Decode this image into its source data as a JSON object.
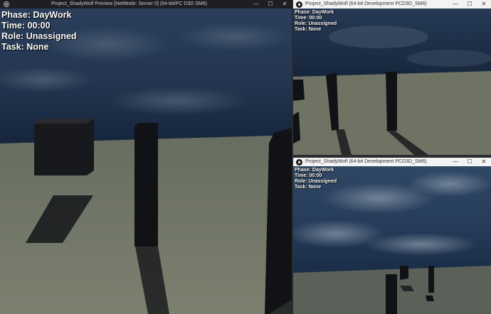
{
  "main_window": {
    "title": "Project_ShadyWolf Preview [NetMode: Server 0]  (64-bit/PC D3D SM6)",
    "hud": {
      "phase": "Phase: DayWork",
      "time": "Time: 00:00",
      "role": "Role: Unassigned",
      "task": "Task: None"
    }
  },
  "client_window_1": {
    "title": "Project_ShadyWolf (64-bit Development PCD3D_SM6)",
    "hud": {
      "phase": "Phase: DayWork",
      "time": "Time: 00:00",
      "role": "Role: Unassigned",
      "task": "Task: None"
    }
  },
  "client_window_2": {
    "title": "Project_ShadyWolf (64-bit Development PCD3D_SM6)",
    "hud": {
      "phase": "Phase: DayWork",
      "time": "Time: 00:00",
      "role": "Role: Unassigned",
      "task": "Task: None"
    }
  },
  "window_controls": {
    "minimize": "—",
    "maximize": "☐",
    "close": "✕"
  },
  "icons": {
    "app": "unreal-engine-logo-icon"
  },
  "colors": {
    "sky": "#1f3550",
    "ground": "#7d8272",
    "pillar": "#121316"
  }
}
